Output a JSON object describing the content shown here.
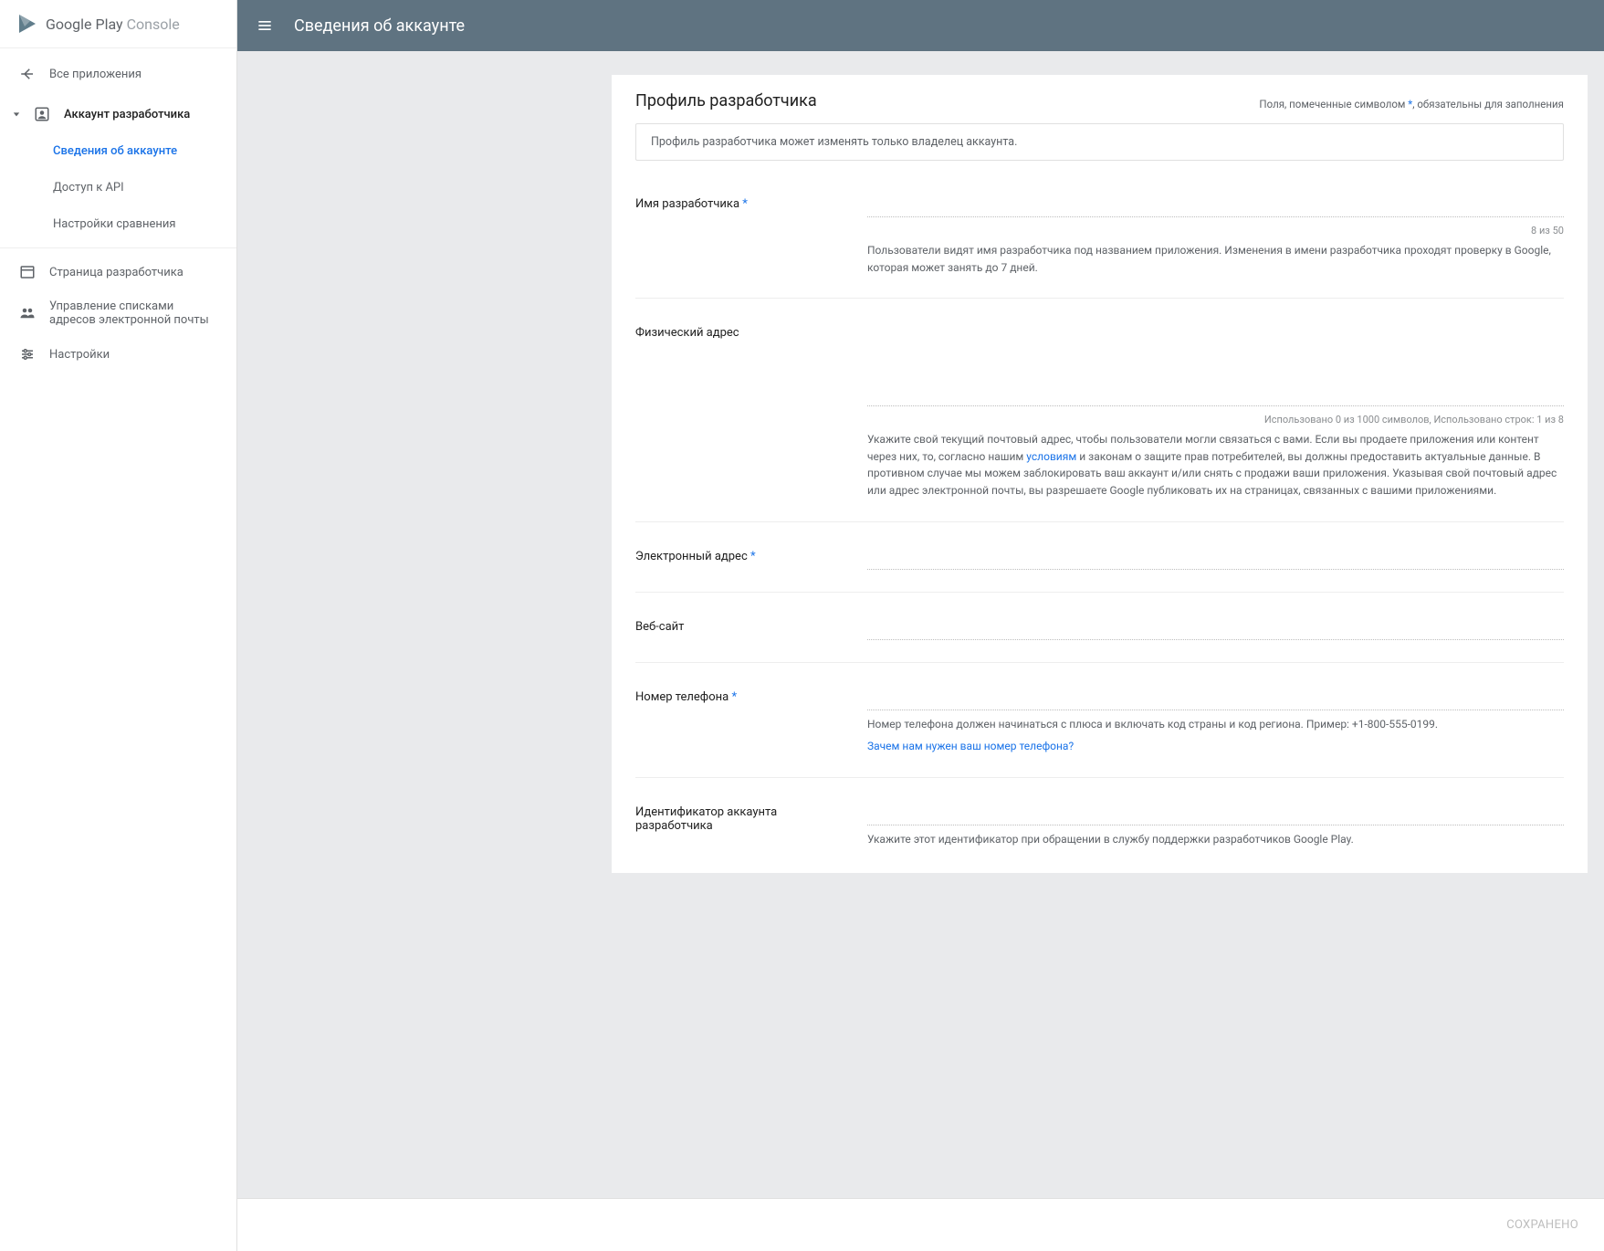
{
  "app": {
    "logo_a": "Google Play",
    "logo_b": "Console"
  },
  "header": {
    "title": "Сведения об аккаунте"
  },
  "sidebar": {
    "all_apps": "Все приложения",
    "dev_account": "Аккаунт разработчика",
    "account_details": "Сведения об аккаунте",
    "api_access": "Доступ к API",
    "compare_settings": "Настройки сравнения",
    "dev_page": "Страница разработчика",
    "email_lists": "Управление списками адресов электронной почты",
    "settings": "Настройки"
  },
  "card": {
    "title": "Профиль разработчика",
    "required_pre": "Поля, помеченные символом ",
    "required_post": ", обязательны для заполнения",
    "info": "Профиль разработчика может изменять только владелец аккаунта."
  },
  "fields": {
    "name": {
      "label": "Имя разработчика",
      "counter": "8 из 50",
      "hint": "Пользователи видят имя разработчика под названием приложения. Изменения в имени разработчика проходят проверку в Google, которая может занять до 7 дней."
    },
    "address": {
      "label": "Физический адрес",
      "counter": "Использовано 0 из 1000 символов, Использовано строк: 1 из 8",
      "hint_pre": "Укажите свой текущий почтовый адрес, чтобы пользователи могли связаться с вами. Если вы продаете приложения или контент через них, то, согласно нашим ",
      "hint_link": "условиям",
      "hint_post": " и законам о защите прав потребителей, вы должны предоставить актуальные данные. В противном случае мы можем заблокировать ваш аккаунт и/или снять с продажи ваши приложения. Указывая свой почтовый адрес или адрес электронной почты, вы разрешаете Google публиковать их на страницах, связанных с вашими приложениями."
    },
    "email": {
      "label": "Электронный адрес"
    },
    "website": {
      "label": "Веб-сайт"
    },
    "phone": {
      "label": "Номер телефона",
      "hint": "Номер телефона должен начинаться с плюса и включать код страны и код региона. Пример: +1-800-555-0199.",
      "link": "Зачем нам нужен ваш номер телефона?"
    },
    "account_id": {
      "label": "Идентификатор аккаунта разработчика",
      "hint": "Укажите этот идентификатор при обращении в службу поддержки разработчиков Google Play."
    }
  },
  "footer": {
    "save": "СОХРАНЕНО"
  }
}
